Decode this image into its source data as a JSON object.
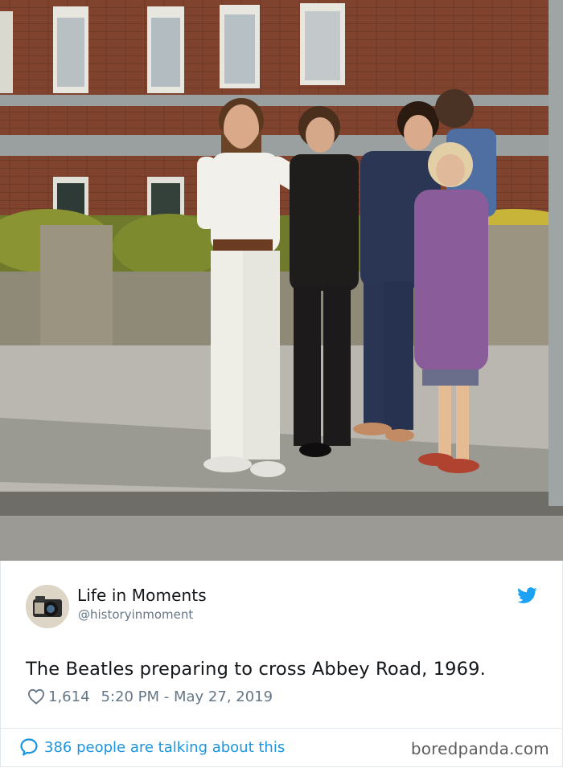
{
  "photo": {
    "description_icon": "photo-image"
  },
  "tweet": {
    "author_name": "Life in Moments",
    "author_handle": "@historyinmoment",
    "text": "The Beatles preparing to cross Abbey Road, 1969.",
    "likes": "1,614",
    "timestamp": "5:20 PM - May 27, 2019",
    "talking": "386 people are talking about this"
  },
  "watermark": "boredpanda.com",
  "colors": {
    "twitter_blue": "#1da1f2",
    "link_blue": "#1b95e0",
    "meta_gray": "#657786",
    "text_dark": "#14171a"
  },
  "icons": {
    "brand": "twitter-bird-icon",
    "like": "heart-icon",
    "talk": "speech-bubble-icon",
    "avatar": "camera-avatar"
  }
}
